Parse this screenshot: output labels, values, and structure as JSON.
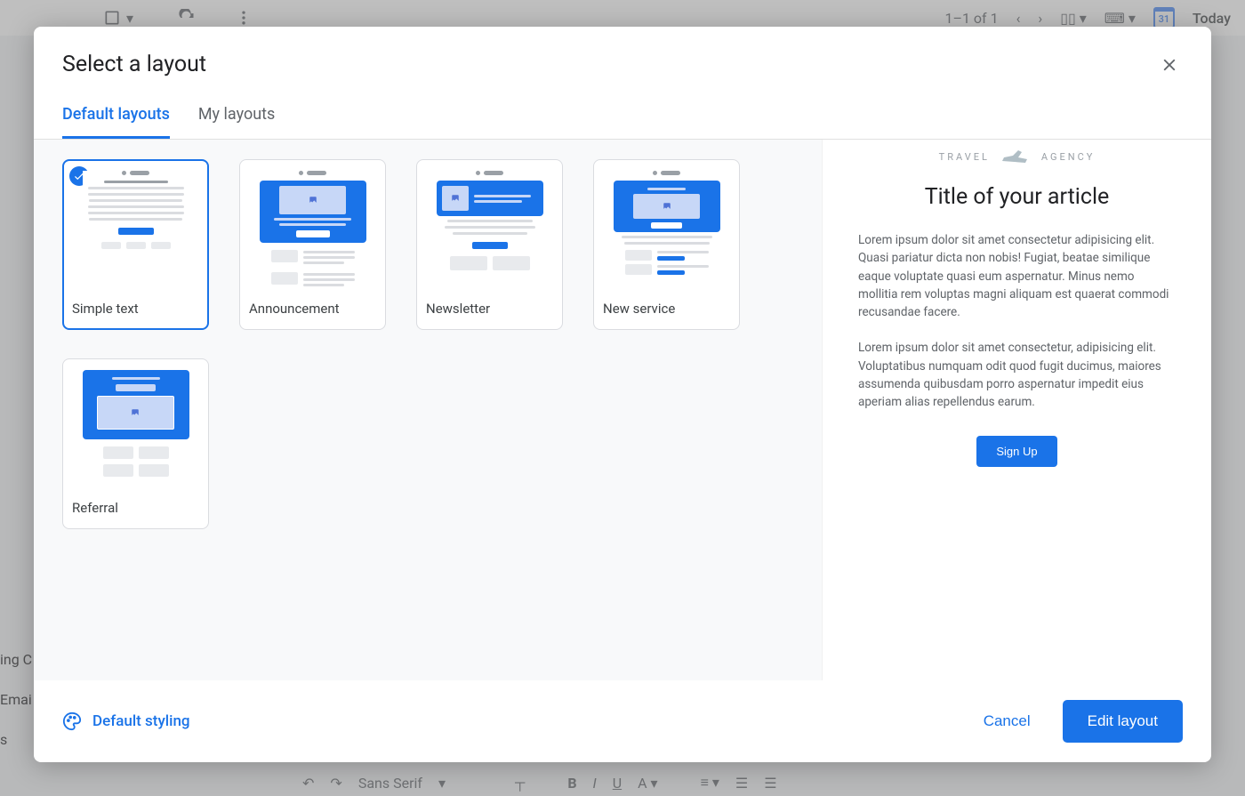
{
  "bg": {
    "pagination": "1–1 of 1",
    "calendar_day": "31",
    "today": "Today",
    "left_text_1": "ing C",
    "left_text_2": "Emai",
    "left_text_3": "s",
    "font": "Sans Serif"
  },
  "modal": {
    "title": "Select a layout",
    "tabs": [
      "Default layouts",
      "My layouts"
    ],
    "active_tab_index": 0,
    "layouts": [
      {
        "label": "Simple text",
        "selected": true
      },
      {
        "label": "Announcement",
        "selected": false
      },
      {
        "label": "Newsletter",
        "selected": false
      },
      {
        "label": "New service",
        "selected": false
      },
      {
        "label": "Referral",
        "selected": false
      }
    ],
    "preview": {
      "logo_left": "TRAVEL",
      "logo_right": "AGENCY",
      "title": "Title of your article",
      "para1": "Lorem ipsum dolor sit amet consectetur adipisicing elit. Quasi pariatur dicta non nobis! Fugiat, beatae similique eaque voluptate quasi eum aspernatur. Minus nemo mollitia rem voluptas magni aliquam est quaerat commodi recusandae facere.",
      "para2": "Lorem ipsum dolor sit amet consectetur, adipisicing elit. Voluptatibus numquam odit quod fugit ducimus, maiores assumenda quibusdam porro aspernatur impedit eius aperiam alias repellendus earum.",
      "cta": "Sign Up"
    },
    "footer": {
      "styling": "Default styling",
      "cancel": "Cancel",
      "edit": "Edit layout"
    }
  }
}
